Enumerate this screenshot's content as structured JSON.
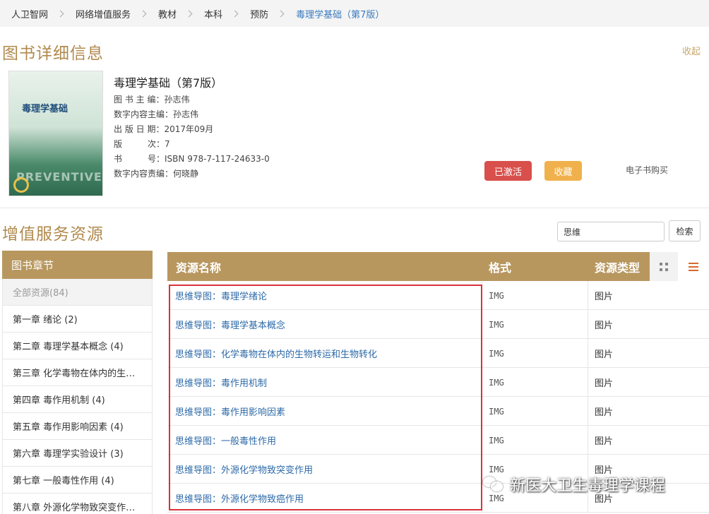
{
  "breadcrumb": {
    "items": [
      "人卫智网",
      "网络增值服务",
      "教材",
      "本科",
      "预防",
      "毒理学基础（第7版）"
    ]
  },
  "book_section": {
    "title": "图书详细信息",
    "collapse_label": "收起"
  },
  "book": {
    "cover_title": "毒理学基础",
    "cover_watermark": "PREVENTIVE",
    "title": "毒理学基础（第7版）",
    "meta": [
      {
        "key": "图 书 主 编：",
        "value": "孙志伟"
      },
      {
        "key": "数字内容主编：",
        "value": "孙志伟"
      },
      {
        "key": "出 版 日 期：",
        "value": "2017年09月"
      },
      {
        "key": "版　　　次：",
        "value": "7"
      },
      {
        "key": "书　　　号：",
        "value": "ISBN 978-7-117-24633-0"
      },
      {
        "key": "数字内容责编：",
        "value": "何晓静"
      }
    ],
    "activated_label": "已激活",
    "favorite_label": "收藏",
    "ebook_label": "电子书购买"
  },
  "resources_section": {
    "title": "增值服务资源",
    "search_value": "思维",
    "search_button": "检索"
  },
  "chapters": {
    "header": "图书章节",
    "items": [
      "全部资源(84)",
      "第一章 绪论 (2)",
      "第二章 毒理学基本概念 (4)",
      "第三章 化学毒物在体内的生…",
      "第四章 毒作用机制 (4)",
      "第五章 毒作用影响因素 (4)",
      "第六章 毒理学实验设计 (3)",
      "第七章 一般毒性作用 (4)",
      "第八章 外源化学物致突变作…"
    ]
  },
  "table": {
    "headers": {
      "name": "资源名称",
      "format": "格式",
      "type": "资源类型"
    },
    "rows": [
      {
        "name": "思维导图：毒理学绪论",
        "format": "IMG",
        "type": "图片"
      },
      {
        "name": "思维导图：毒理学基本概念",
        "format": "IMG",
        "type": "图片"
      },
      {
        "name": "思维导图：化学毒物在体内的生物转运和生物转化",
        "format": "IMG",
        "type": "图片"
      },
      {
        "name": "思维导图：毒作用机制",
        "format": "IMG",
        "type": "图片"
      },
      {
        "name": "思维导图：毒作用影响因素",
        "format": "IMG",
        "type": "图片"
      },
      {
        "name": "思维导图：一般毒性作用",
        "format": "IMG",
        "type": "图片"
      },
      {
        "name": "思维导图：外源化学物致突变作用",
        "format": "IMG",
        "type": "图片"
      },
      {
        "name": "思维导图：外源化学物致癌作用",
        "format": "IMG",
        "type": "图片"
      }
    ]
  },
  "watermark_text": "新医大卫生毒理学课程",
  "colors": {
    "accent": "#b8975f",
    "link": "#2d6aa8",
    "danger": "#d94f4b",
    "warning": "#f0b14c"
  }
}
